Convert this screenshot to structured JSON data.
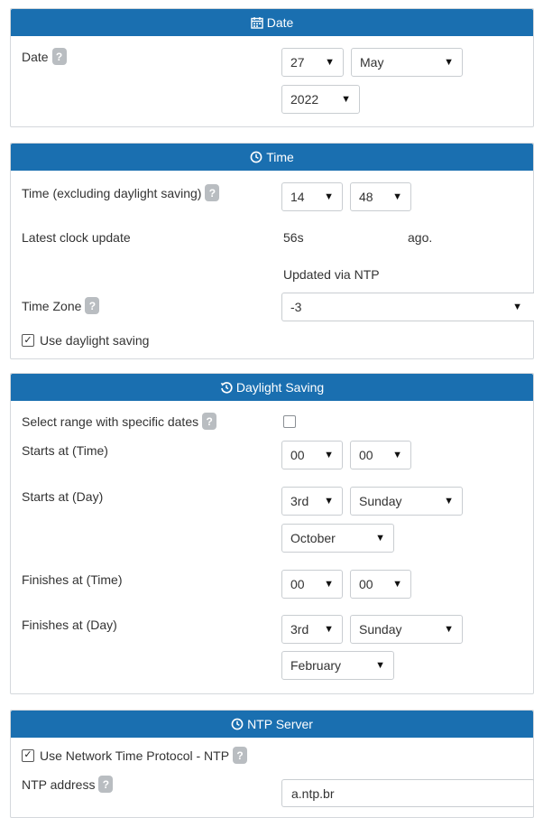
{
  "colors": {
    "accent": "#1a6fb0",
    "help_badge": "#b9bdc1",
    "border": "#d4d8dc"
  },
  "date_panel": {
    "title": "Date",
    "date_label": "Date",
    "day": "27",
    "month": "May",
    "year": "2022"
  },
  "time_panel": {
    "title": "Time",
    "time_label": "Time (excluding daylight saving)",
    "hour": "14",
    "minute": "48",
    "latest_update_label": "Latest clock update",
    "latest_update_value": "56s",
    "latest_update_suffix": "ago.",
    "updated_via": "Updated via NTP",
    "timezone_label": "Time Zone",
    "timezone_value": "-3",
    "use_dst_label": "Use daylight saving",
    "use_dst_checked": true
  },
  "dst_panel": {
    "title": "Daylight Saving",
    "range_label": "Select range with specific dates",
    "range_checked": false,
    "starts_time_label": "Starts at (Time)",
    "starts_hour": "00",
    "starts_minute": "00",
    "starts_day_label": "Starts at (Day)",
    "starts_ordinal": "3rd",
    "starts_weekday": "Sunday",
    "starts_month": "October",
    "finishes_time_label": "Finishes at (Time)",
    "finishes_hour": "00",
    "finishes_minute": "00",
    "finishes_day_label": "Finishes at (Day)",
    "finishes_ordinal": "3rd",
    "finishes_weekday": "Sunday",
    "finishes_month": "February"
  },
  "ntp_panel": {
    "title": "NTP Server",
    "use_ntp_label": "Use Network Time Protocol - NTP",
    "use_ntp_checked": true,
    "address_label": "NTP address",
    "address_value": "a.ntp.br"
  },
  "help_glyph": "?",
  "check_glyph": "✓",
  "dropdown_arrow": "▼"
}
